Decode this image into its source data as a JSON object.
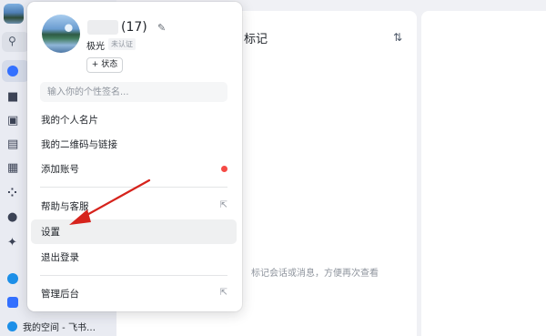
{
  "app": {
    "sidebar_bottom_item": "我的空间 - 飞书…"
  },
  "middle_panel": {
    "title": "标记",
    "empty_hint": "标记会话或消息，方便再次查看"
  },
  "profile": {
    "count": "(17)",
    "org_name": "极光",
    "cert_badge": "未认证",
    "status_button": "+ 状态",
    "signature_placeholder": "输入你的个性签名..."
  },
  "menu": {
    "items": [
      {
        "label": "我的个人名片"
      },
      {
        "label": "我的二维码与链接"
      },
      {
        "label": "添加账号"
      },
      {
        "label": "帮助与客服"
      },
      {
        "label": "设置"
      },
      {
        "label": "退出登录"
      },
      {
        "label": "管理后台"
      }
    ]
  },
  "colors": {
    "accent_blue": "#3370ff",
    "notification_red": "#f54a45",
    "annotation_arrow": "#d6231c",
    "hover_bg": "#eff0f1"
  },
  "icons": {
    "edit": "pencil-icon",
    "external": "external-link-icon",
    "sort": "sort-arrows-icon",
    "search": "search-icon"
  }
}
